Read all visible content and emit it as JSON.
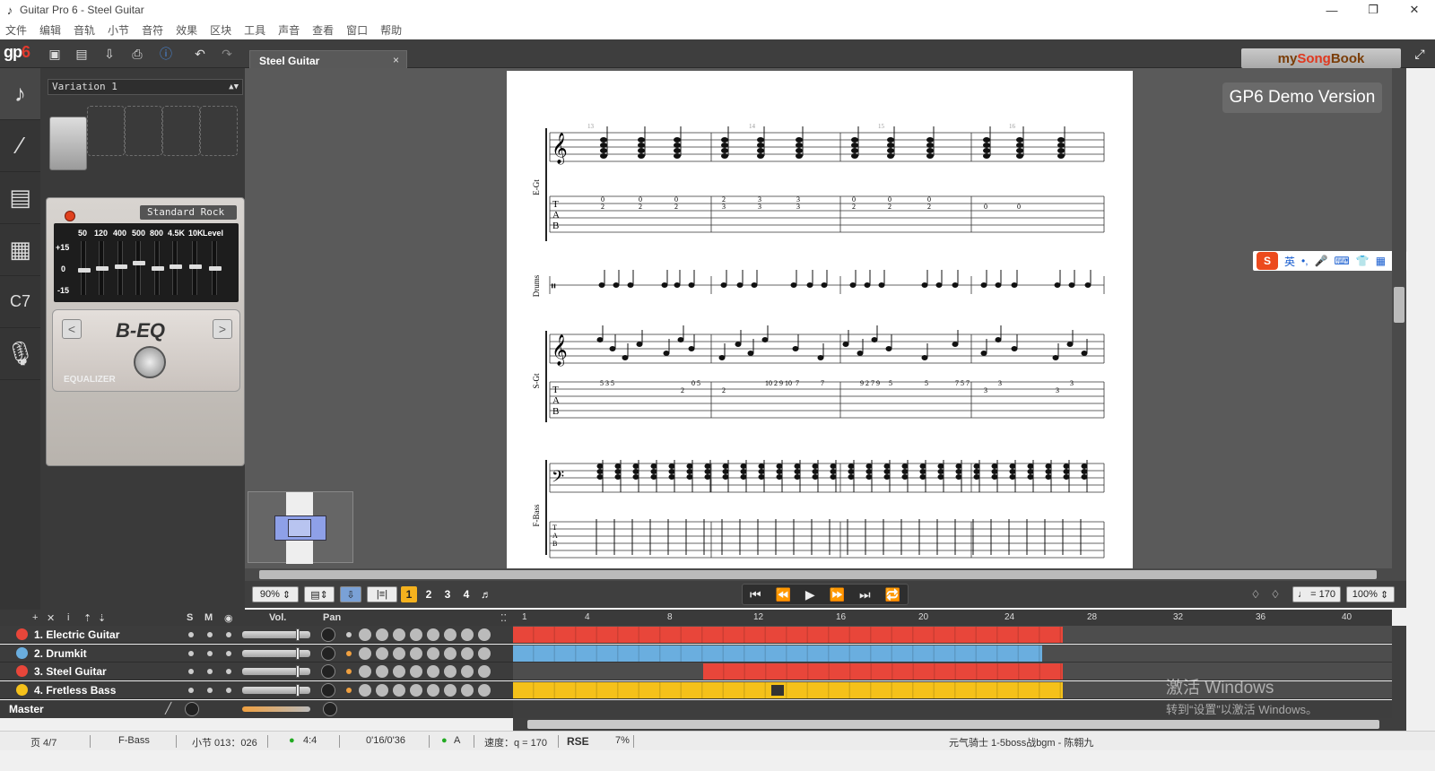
{
  "window": {
    "title": "Guitar Pro 6 - Steel Guitar",
    "minimize": "—",
    "maximize": "❐",
    "close": "✕"
  },
  "menu": [
    "文件",
    "编辑",
    "音轨",
    "小节",
    "音符",
    "效果",
    "区块",
    "工具",
    "声音",
    "查看",
    "窗口",
    "帮助"
  ],
  "toolbar": {
    "logo": "gp",
    "logo_accent": "6"
  },
  "document_tab": {
    "label": "Steel Guitar",
    "close": "×"
  },
  "mysongbook": {
    "prefix": "my",
    "accent": "Song",
    "suffix": "Book"
  },
  "demo_badge": "GP6 Demo Version",
  "fx_panel": {
    "variation": "Variation 1",
    "eq_preset": "Standard Rock",
    "eq_bands": [
      "50",
      "120",
      "400",
      "500",
      "800",
      "4.5K",
      "10K",
      "Level"
    ],
    "eq_scale": [
      "+15",
      "0",
      "-15"
    ],
    "pedal_name": "B-EQ",
    "pedal_label": "EQUALIZER",
    "prev": "<",
    "next": ">"
  },
  "score": {
    "staves": [
      "E-Gt",
      "Drums",
      "S-Gt",
      "F-Bass"
    ],
    "measure_numbers": [
      "13",
      "14",
      "15",
      "16"
    ],
    "sgt_tab_line": [
      "5 3 5",
      "2",
      "0 5",
      "2",
      "10 2 9 10",
      "7",
      "7",
      "9 2 7 9",
      "5",
      "5",
      "7 5 7",
      "3",
      "3",
      "3",
      "3"
    ],
    "egt_tab_rows": [
      [
        "0",
        "0",
        "0",
        "2",
        "3",
        "3",
        "0",
        "0",
        "0",
        "",
        ""
      ],
      [
        "2",
        "2",
        "2",
        "3",
        "3",
        "3",
        "2",
        "2",
        "2",
        "0",
        "0"
      ]
    ]
  },
  "ime": {
    "logo": "S",
    "items": [
      "英",
      "•,",
      "🎤",
      "⌨",
      "👕",
      "▦"
    ]
  },
  "controls": {
    "zoom": "90%",
    "voices": [
      "1",
      "2",
      "3",
      "4"
    ],
    "tempo": "♩ = 170",
    "volume": "100%"
  },
  "track_header": {
    "s": "S",
    "m": "M",
    "vol": "Vol.",
    "pan": "Pan"
  },
  "tracks": [
    {
      "name": "1. Electric Guitar",
      "color": "#e8463a"
    },
    {
      "name": "2. Drumkit",
      "color": "#6aaedf"
    },
    {
      "name": "3. Steel Guitar",
      "color": "#e8463a"
    },
    {
      "name": "4. Fretless Bass",
      "color": "#f5c11a"
    }
  ],
  "master": "Master",
  "timeline": [
    "1",
    "4",
    "8",
    "12",
    "16",
    "20",
    "24",
    "28",
    "32",
    "36",
    "40"
  ],
  "activation": {
    "line1": "激活 Windows",
    "line2": "转到“设置”以激活 Windows。"
  },
  "status": {
    "page": "页 4/7",
    "track": "F-Bass",
    "bar": "小节 013：026",
    "signature": "4:4",
    "time": "0'16/0'36",
    "key": "A",
    "tempo": "速度：q = 170",
    "rse": "RSE",
    "rse_value": "7%",
    "song": "元气骑士 1-5boss战bgm - 陈翱九"
  }
}
